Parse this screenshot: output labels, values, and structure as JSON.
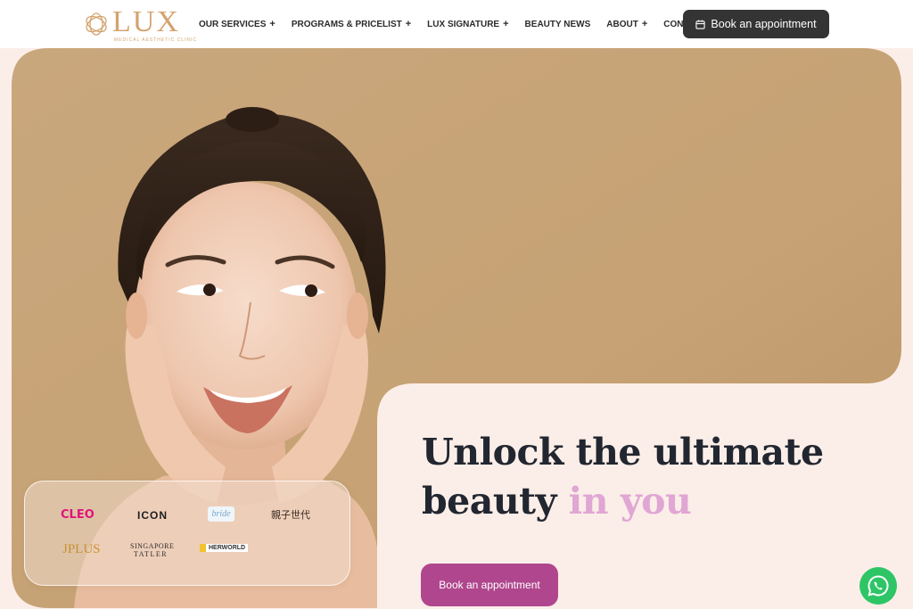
{
  "header": {
    "logo_text": "LUX",
    "logo_tagline": "MEDICAL AESTHETIC CLINIC",
    "nav": [
      {
        "label": "OUR SERVICES",
        "has_submenu": true
      },
      {
        "label": "PROGRAMS & PRICELIST",
        "has_submenu": true
      },
      {
        "label": "LUX SIGNATURE",
        "has_submenu": true
      },
      {
        "label": "BEAUTY NEWS",
        "has_submenu": false
      },
      {
        "label": "ABOUT",
        "has_submenu": true
      },
      {
        "label": "CONTACT",
        "has_submenu": false
      }
    ],
    "submenu_glyph": "+",
    "book_button": "Book an appointment",
    "book_icon": "calendar-icon"
  },
  "hero": {
    "headline_line1": "Unlock the ultimate",
    "headline_line2_plain": "beauty",
    "headline_line2_accent": "in you",
    "cta_label": "Book an appointment"
  },
  "press_logos": [
    "CLEO",
    "ICON",
    "bride",
    "親子世代",
    "JPLUS",
    "SINGAPORE",
    "TATLER",
    "HERWORLD"
  ],
  "colors": {
    "brand_gold": "#d3a36e",
    "hero_tan": "#c9a77d",
    "page_pink": "#fbeee8",
    "cta_magenta": "#b0478e",
    "accent_pink": "#e0a6d4",
    "header_button": "#343434",
    "whatsapp_green": "#2ec566"
  },
  "floating_widget": {
    "icon": "whatsapp-icon"
  }
}
